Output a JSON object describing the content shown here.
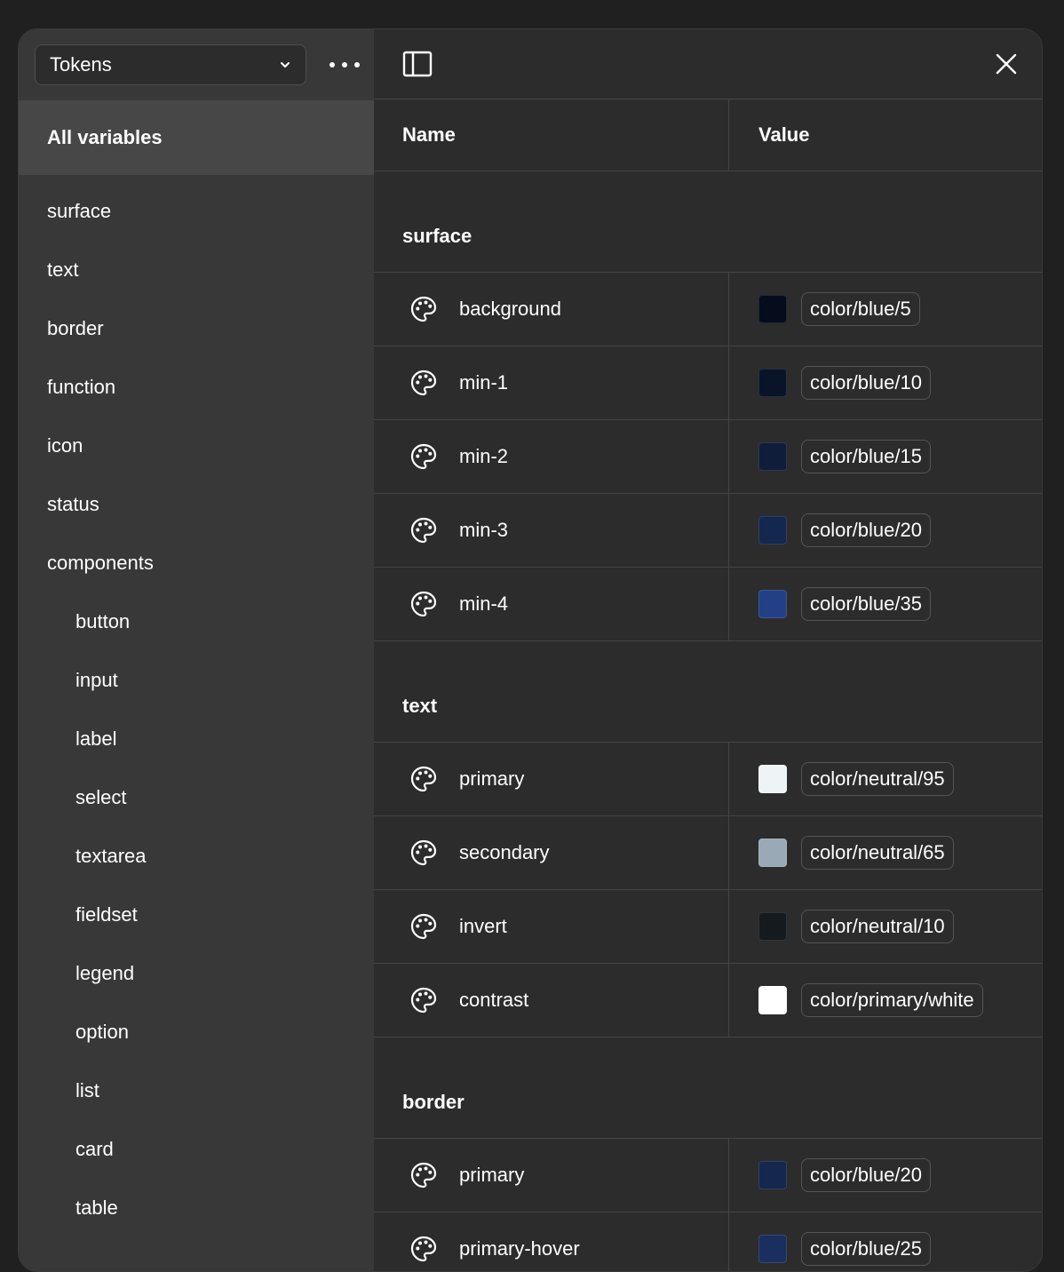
{
  "sidebar": {
    "collection": "Tokens",
    "all_label": "All variables",
    "groups": [
      "surface",
      "text",
      "border",
      "function",
      "icon",
      "status",
      "components"
    ],
    "subgroups": [
      "button",
      "input",
      "label",
      "select",
      "textarea",
      "fieldset",
      "legend",
      "option",
      "list",
      "card",
      "table"
    ]
  },
  "table": {
    "name_header": "Name",
    "value_header": "Value"
  },
  "sections": [
    {
      "title": "surface",
      "rows": [
        {
          "name": "background",
          "alias": "color/blue/5",
          "swatch": "#050c1b"
        },
        {
          "name": "min-1",
          "alias": "color/blue/10",
          "swatch": "#0a1429"
        },
        {
          "name": "min-2",
          "alias": "color/blue/15",
          "swatch": "#0f1d3b"
        },
        {
          "name": "min-3",
          "alias": "color/blue/20",
          "swatch": "#14274e"
        },
        {
          "name": "min-4",
          "alias": "color/blue/35",
          "swatch": "#233f85"
        }
      ]
    },
    {
      "title": "text",
      "rows": [
        {
          "name": "primary",
          "alias": "color/neutral/95",
          "swatch": "#eef3f6"
        },
        {
          "name": "secondary",
          "alias": "color/neutral/65",
          "swatch": "#99a9b5"
        },
        {
          "name": "invert",
          "alias": "color/neutral/10",
          "swatch": "#151a1e"
        },
        {
          "name": "contrast",
          "alias": "color/primary/white",
          "swatch": "#ffffff"
        }
      ]
    },
    {
      "title": "border",
      "rows": [
        {
          "name": "primary",
          "alias": "color/blue/20",
          "swatch": "#14274e"
        },
        {
          "name": "primary-hover",
          "alias": "color/blue/25",
          "swatch": "#1a2f60"
        }
      ]
    }
  ]
}
